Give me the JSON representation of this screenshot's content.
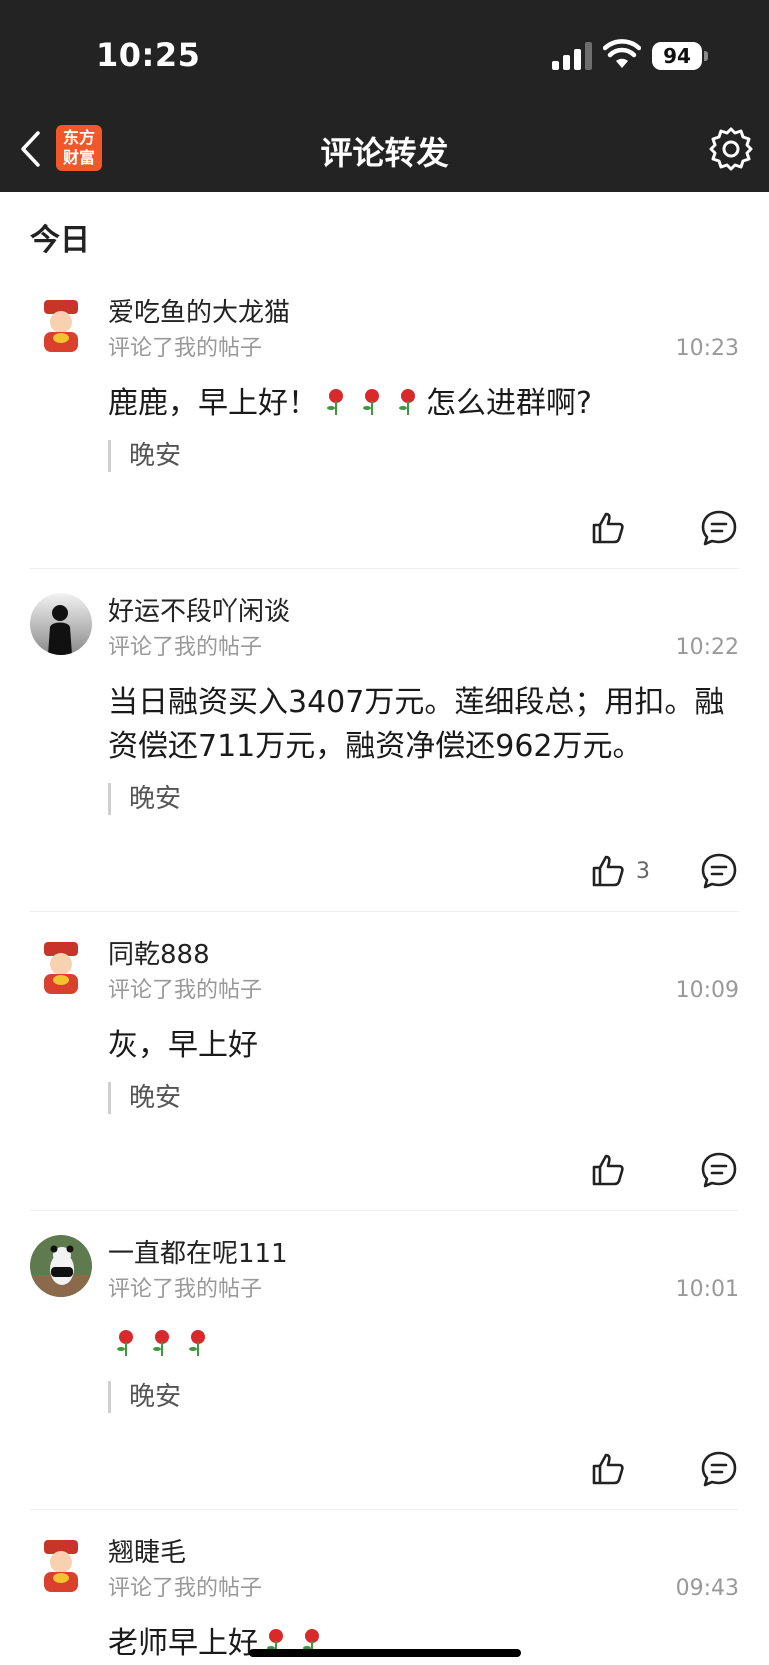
{
  "status_bar": {
    "time": "10:25",
    "battery": "94"
  },
  "nav": {
    "title": "评论转发",
    "logo_line1": "东方",
    "logo_line2": "财富"
  },
  "section": {
    "label": "今日"
  },
  "items": [
    {
      "username": "爱吃鱼的大龙猫",
      "action": "评论了我的帖子",
      "time": "10:23",
      "text_a": "鹿鹿，早上好！",
      "text_b": "怎么进群啊?",
      "quote": "晚安",
      "likes": ""
    },
    {
      "username": "好运不段吖闲谈",
      "action": "评论了我的帖子",
      "time": "10:22",
      "text": "当日融资买入3407万元。莲细段总；用扣。融资偿还711万元，融资净偿还962万元。",
      "quote": "晚安",
      "likes": "3"
    },
    {
      "username": "同乾888",
      "action": "评论了我的帖子",
      "time": "10:09",
      "text": "灰，早上好",
      "quote": "晚安",
      "likes": ""
    },
    {
      "username": "一直都在呢111",
      "action": "评论了我的帖子",
      "time": "10:01",
      "text": "",
      "quote": "晚安",
      "likes": ""
    },
    {
      "username": "翘睫毛",
      "action": "评论了我的帖子",
      "time": "09:43",
      "text": "老师早上好",
      "quote": "",
      "likes": ""
    }
  ],
  "colors": {
    "header_bg": "#232323",
    "brand": "#f2572a",
    "muted": "#999999"
  },
  "icons": [
    "back-arrow-icon",
    "eastmoney-logo",
    "gear-icon",
    "thumbs-up-icon",
    "comment-bubble-icon",
    "rose-emoji"
  ]
}
